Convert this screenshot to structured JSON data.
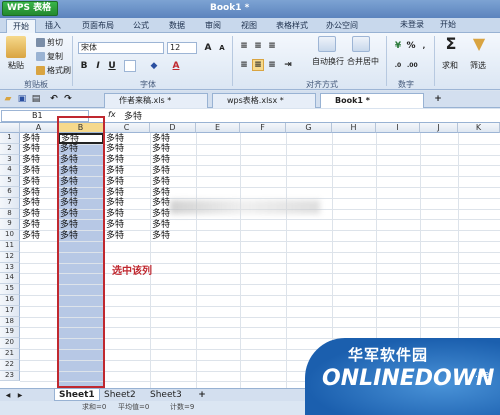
{
  "app": {
    "button": "WPS 表格",
    "title": "Book1 *"
  },
  "ribbon_tabs": [
    "开始",
    "插入",
    "页面布局",
    "公式",
    "数据",
    "审阅",
    "视图",
    "表格样式",
    "办公空间"
  ],
  "ribbon_right": {
    "login": "未登录",
    "mode": "开始"
  },
  "clipboard": {
    "paste": "粘贴",
    "cut": "剪切",
    "copy": "复制",
    "format": "格式刷",
    "group": "剪贴板"
  },
  "font": {
    "name": "宋体",
    "size": "12",
    "group": "字体"
  },
  "align": {
    "wrap": "自动换行",
    "merge": "合并居中",
    "group": "对齐方式"
  },
  "number": {
    "percent": "%",
    "group": "数字"
  },
  "editing": {
    "sum": "求和",
    "filter": "筛选"
  },
  "doc_tabs": [
    "作者来稿.xls *",
    "wps表格.xlsx *",
    "Book1 *"
  ],
  "formula": {
    "cell_ref": "B1",
    "fx": "fx",
    "value": "多特"
  },
  "columns": [
    "A",
    "B",
    "C",
    "D",
    "E",
    "F",
    "G",
    "H",
    "I",
    "J",
    "K"
  ],
  "rows": [
    "1",
    "2",
    "3",
    "4",
    "5",
    "6",
    "7",
    "8",
    "9",
    "10",
    "11",
    "12",
    "13",
    "14",
    "15",
    "16",
    "17",
    "18",
    "19",
    "20",
    "21",
    "22",
    "23"
  ],
  "cell_text": "多特",
  "annotation": "选中该列",
  "sheets": [
    "Sheet1",
    "Sheet2",
    "Sheet3"
  ],
  "status": {
    "sum": "求和=0",
    "avg": "平均值=0",
    "count": "计数=9"
  },
  "watermark": {
    "cn": "华军软件园",
    "en": "ONLINEDOWN",
    "suffix": ".net"
  }
}
